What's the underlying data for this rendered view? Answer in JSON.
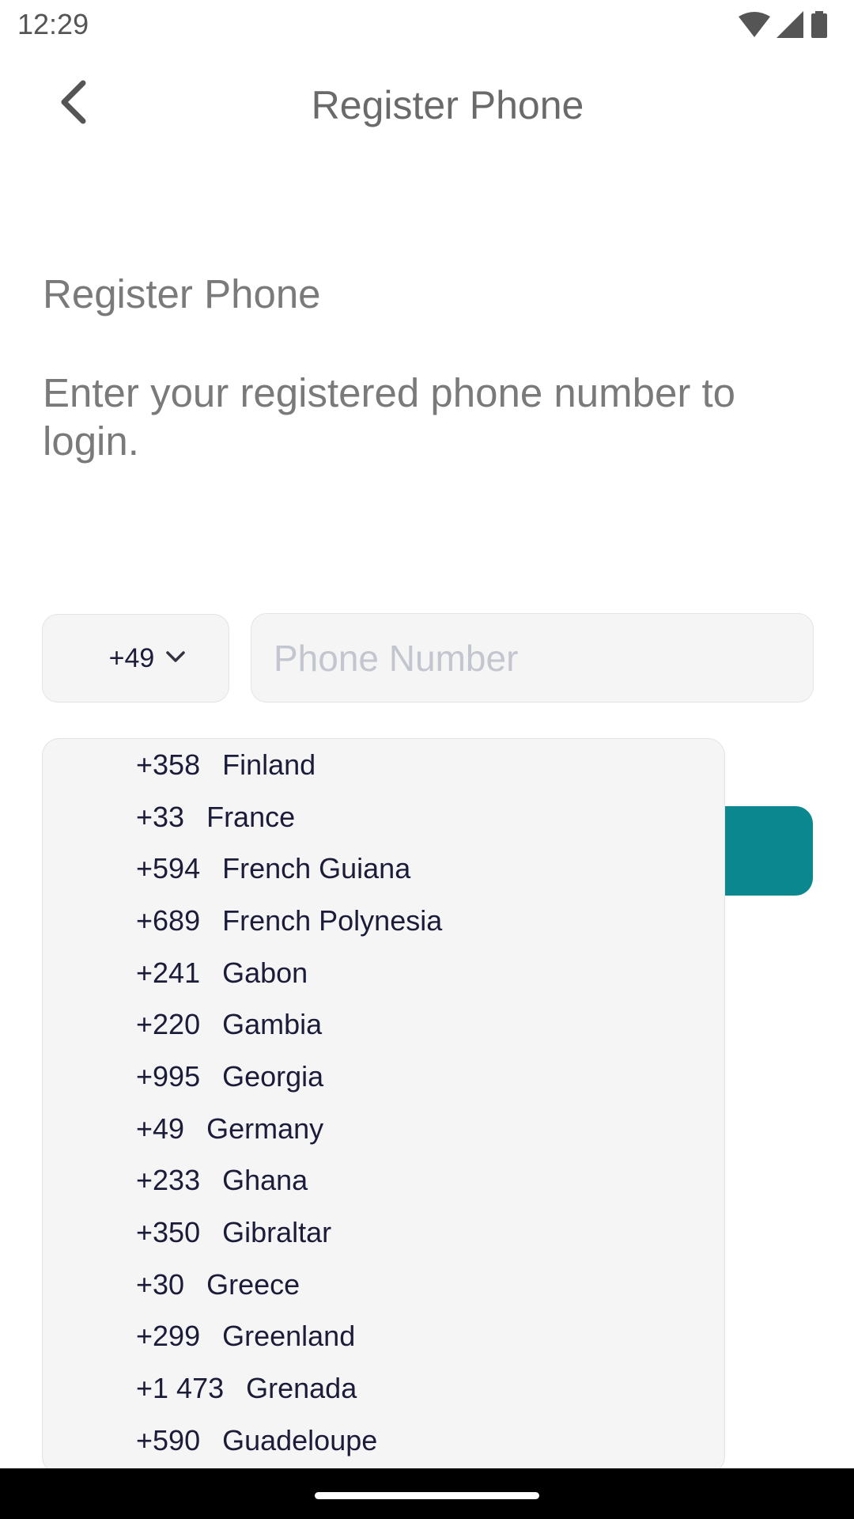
{
  "status_bar": {
    "time": "12:29",
    "icons": [
      "wifi-icon",
      "cellular-signal-icon",
      "battery-icon"
    ]
  },
  "app_bar": {
    "back_icon": "chevron-left-icon",
    "title": "Register Phone"
  },
  "content": {
    "heading": "Register Phone",
    "description": "Enter your registered phone number to login."
  },
  "country_code_select": {
    "selected_value": "+49",
    "icon": "chevron-down-icon"
  },
  "phone_input": {
    "value": "",
    "placeholder": "Phone Number"
  },
  "continue_button": {
    "color": "#0b8790"
  },
  "dropdown": {
    "options": [
      {
        "code": "+358",
        "country": "Finland"
      },
      {
        "code": "+33",
        "country": "France"
      },
      {
        "code": "+594",
        "country": "French Guiana"
      },
      {
        "code": "+689",
        "country": "French Polynesia"
      },
      {
        "code": "+241",
        "country": "Gabon"
      },
      {
        "code": "+220",
        "country": "Gambia"
      },
      {
        "code": "+995",
        "country": "Georgia"
      },
      {
        "code": "+49",
        "country": "Germany"
      },
      {
        "code": "+233",
        "country": "Ghana"
      },
      {
        "code": "+350",
        "country": "Gibraltar"
      },
      {
        "code": "+30",
        "country": "Greece"
      },
      {
        "code": "+299",
        "country": "Greenland"
      },
      {
        "code": "+1 473",
        "country": "Grenada"
      },
      {
        "code": "+590",
        "country": "Guadeloupe"
      }
    ]
  },
  "colors": {
    "accent": "#0b8790",
    "text_dark": "#1b1b3a",
    "text_muted": "#7a7a7a",
    "field_background": "#f5f5f5"
  }
}
